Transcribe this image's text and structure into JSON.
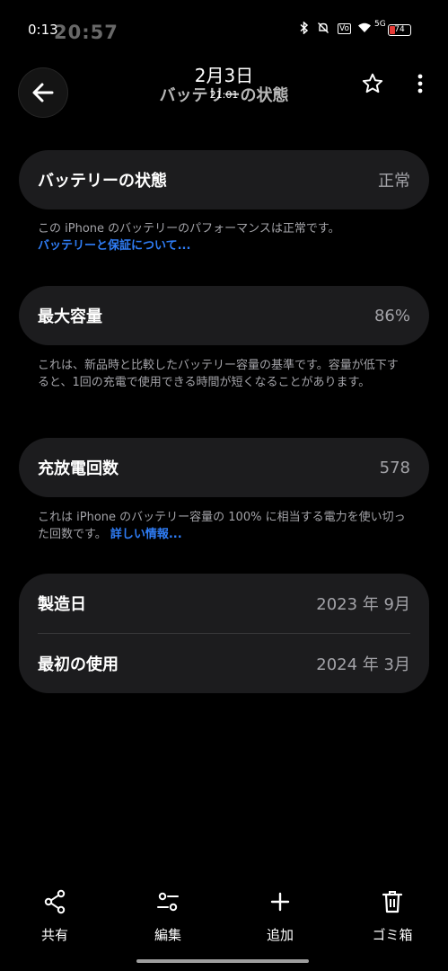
{
  "status_bar": {
    "time": "0:13",
    "ghost_time": "20:57",
    "battery_level": "74",
    "signal_text": "5G",
    "battery_color": "#e53935"
  },
  "header": {
    "date": "2月3日",
    "title": "バッテリーの状態",
    "subtime": "21:01",
    "icons": [
      "back-arrow-icon",
      "star-icon",
      "more-vert-icon"
    ]
  },
  "battery_health": {
    "label": "バッテリーの状態",
    "value": "正常",
    "note": "この iPhone のバッテリーのパフォーマンスは正常です。",
    "link": "バッテリーと保証について..."
  },
  "max_capacity": {
    "label": "最大容量",
    "value": "86%",
    "note": "これは、新品時と比較したバッテリー容量の基準です。容量が低下すると、1回の充電で使用できる時間が短くなることがあります。"
  },
  "cycle_count": {
    "label": "充放電回数",
    "value": "578",
    "note": "これは iPhone のバッテリー容量の 100% に相当する電力を使い切った回数です。",
    "link": "詳しい情報..."
  },
  "dates": {
    "manufactured_label": "製造日",
    "manufactured_value": "2023 年 9月",
    "first_use_label": "最初の使用",
    "first_use_value": "2024 年 3月"
  },
  "bottom_bar": {
    "share": "共有",
    "edit": "編集",
    "add": "追加",
    "trash": "ゴミ箱"
  },
  "colors": {
    "background": "#000000",
    "card": "#1c1c1e",
    "secondary_text": "#a3a3a8",
    "link": "#2f7df6"
  }
}
